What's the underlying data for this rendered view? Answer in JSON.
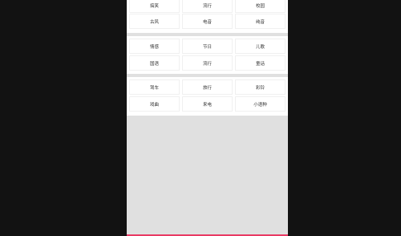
{
  "groups": [
    {
      "rows": [
        [
          "搞笑",
          "流行",
          "校园"
        ],
        [
          "古风",
          "电音",
          "纯音"
        ]
      ]
    },
    {
      "rows": [
        [
          "情感",
          "节日",
          "儿歌"
        ],
        [
          "国语",
          "流行",
          "童话"
        ]
      ]
    },
    {
      "rows": [
        [
          "驾车",
          "旅行",
          "彩铃"
        ],
        [
          "戏曲",
          "来电",
          "小语种"
        ]
      ]
    }
  ],
  "colors": {
    "accent_bar": "#e93a63",
    "panel_bg": "#e0e0e0"
  }
}
